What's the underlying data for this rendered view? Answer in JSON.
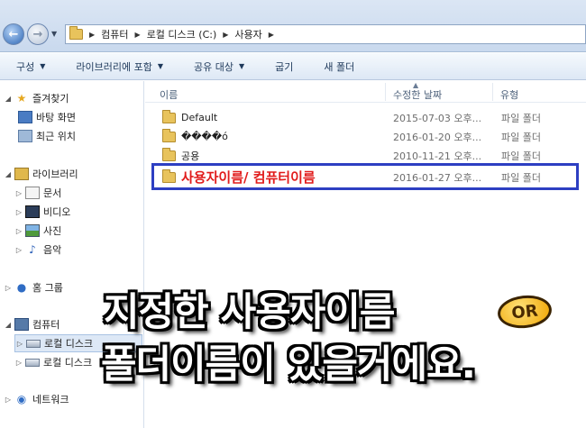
{
  "address": {
    "crumbs": [
      "컴퓨터",
      "로컬 디스크 (C:)",
      "사용자"
    ]
  },
  "toolbar": {
    "organize": "구성",
    "library": "라이브러리에 포함",
    "share": "공유 대상",
    "burn": "굽기",
    "newfolder": "새 폴더"
  },
  "nav": {
    "favorites": "즐겨찾기",
    "desktop": "바탕 화면",
    "recent": "최근 위치",
    "libraries": "라이브러리",
    "documents": "문서",
    "videos": "비디오",
    "pictures": "사진",
    "music": "음악",
    "homegroup": "홈 그룹",
    "computer": "컴퓨터",
    "drive_c": "로컬 디스크",
    "drive_d": "로컬 디스크",
    "network": "네트워크"
  },
  "columns": {
    "name": "이름",
    "modified": "수정한 날짜",
    "type": "유형"
  },
  "files": [
    {
      "name": "Default",
      "date": "2015-07-03 오후...",
      "type": "파일 폴더"
    },
    {
      "name": "����ó",
      "date": "2016-01-20 오후...",
      "type": "파일 폴더"
    },
    {
      "name": "공용",
      "date": "2010-11-21 오후...",
      "type": "파일 폴더"
    },
    {
      "name": "사용자이름/ 컴퓨터이름",
      "date": "2016-01-27 오후...",
      "type": "파일 폴더"
    }
  ],
  "overlay": {
    "line1": "지정한 사용자이름",
    "or": "OR",
    "line2": "폴더이름이 있을거에요."
  },
  "colors": {
    "highlight_border": "#2d3fc2",
    "label_red": "#e11b1b"
  }
}
